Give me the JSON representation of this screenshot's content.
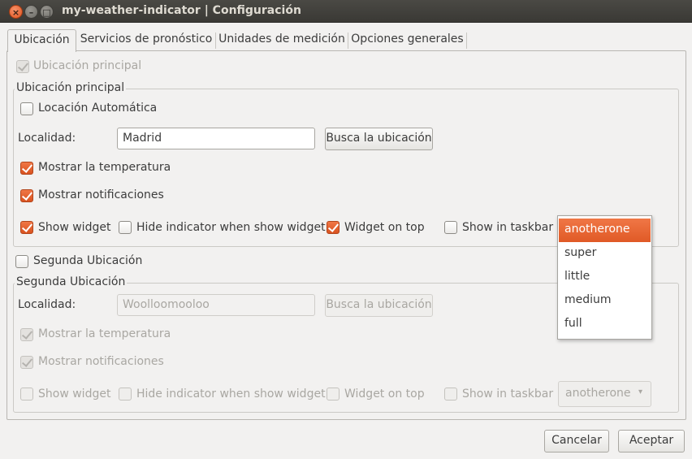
{
  "window": {
    "title": "my-weather-indicator | Configuración",
    "close_glyph": "×",
    "minimize_glyph": "–",
    "maximize_glyph": "□"
  },
  "tabs": [
    {
      "label": "Ubicación",
      "active": true
    },
    {
      "label": "Servicios de pronóstico",
      "active": false
    },
    {
      "label": "Unidades de medición",
      "active": false
    },
    {
      "label": "Opciones generales",
      "active": false
    }
  ],
  "main_location_toggle": {
    "label": "Ubicación principal",
    "checked": true,
    "enabled": false
  },
  "main_frame": {
    "title": "Ubicación principal",
    "auto_location": {
      "label": "Locación Automática",
      "checked": false
    },
    "locality_label": "Localidad:",
    "locality_value": "Madrid",
    "search_button": "Busca la ubicación",
    "show_temperature": {
      "label": "Mostrar la temperatura",
      "checked": true
    },
    "show_notifications": {
      "label": "Mostrar notificaciones",
      "checked": true
    },
    "show_widget": {
      "label": "Show widget",
      "checked": true
    },
    "hide_indicator": {
      "label": "Hide indicator when show widget",
      "checked": false
    },
    "widget_on_top": {
      "label": "Widget on top",
      "checked": true
    },
    "show_in_taskbar": {
      "label": "Show in taskbar",
      "checked": false
    }
  },
  "skin_dropdown": {
    "options": [
      "anotherone",
      "super",
      "little",
      "medium",
      "full"
    ],
    "selected": "anotherone"
  },
  "second_location_toggle": {
    "label": "Segunda Ubicación",
    "checked": false
  },
  "second_frame": {
    "title": "Segunda Ubicación",
    "locality_label": "Localidad:",
    "locality_value": "Woolloomooloo",
    "search_button": "Busca la ubicación",
    "show_temperature": {
      "label": "Mostrar la temperatura",
      "checked": true
    },
    "show_notifications": {
      "label": "Mostrar notificaciones",
      "checked": true
    },
    "show_widget": {
      "label": "Show widget",
      "checked": false
    },
    "hide_indicator": {
      "label": "Hide indicator when show widget",
      "checked": false
    },
    "widget_on_top": {
      "label": "Widget on top",
      "checked": false
    },
    "show_in_taskbar": {
      "label": "Show in taskbar",
      "checked": false
    },
    "skin_value": "anotherone"
  },
  "footer": {
    "cancel": "Cancelar",
    "accept": "Aceptar"
  },
  "colors": {
    "accent": "#e05a26",
    "window_bg": "#f2f1f0",
    "titlebar": "#3c3b37"
  },
  "icons": {
    "combo_arrow": "▾"
  }
}
